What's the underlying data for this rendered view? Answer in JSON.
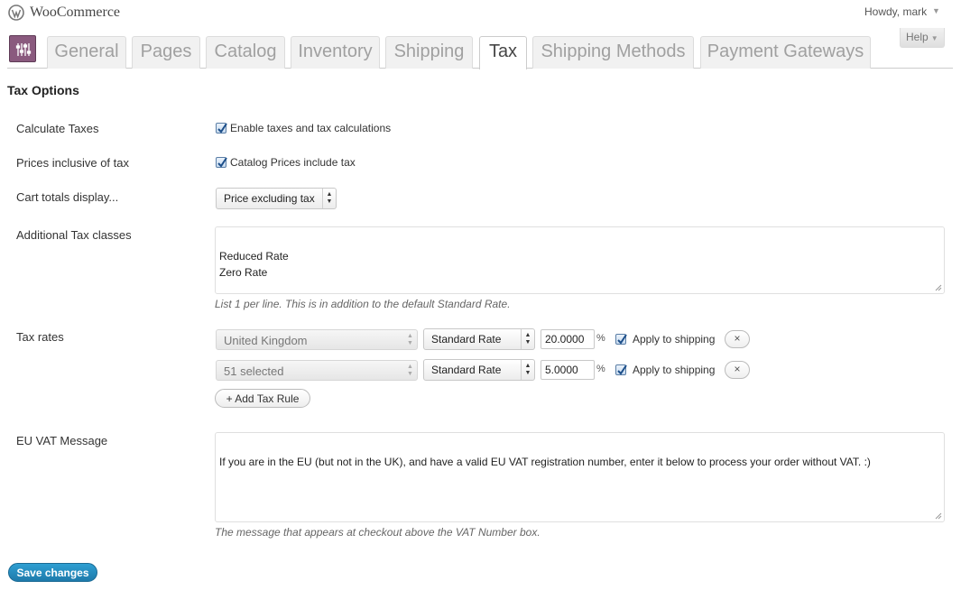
{
  "topbar": {
    "site_name": "WooCommerce",
    "howdy": "Howdy, mark",
    "howdy_arrow": "▼",
    "help": "Help",
    "help_arrow": "▼"
  },
  "tabs": [
    {
      "label": "General",
      "active": false
    },
    {
      "label": "Pages",
      "active": false
    },
    {
      "label": "Catalog",
      "active": false
    },
    {
      "label": "Inventory",
      "active": false
    },
    {
      "label": "Shipping",
      "active": false
    },
    {
      "label": "Tax",
      "active": true
    },
    {
      "label": "Shipping Methods",
      "active": false
    },
    {
      "label": "Payment Gateways",
      "active": false
    }
  ],
  "section_title": "Tax Options",
  "fields": {
    "calculate_taxes": {
      "label": "Calculate Taxes",
      "checkbox_label": "Enable taxes and tax calculations",
      "checked": true
    },
    "prices_inclusive": {
      "label": "Prices inclusive of tax",
      "checkbox_label": "Catalog Prices include tax",
      "checked": true
    },
    "cart_totals": {
      "label": "Cart totals display...",
      "value": "Price excluding tax"
    },
    "tax_classes": {
      "label": "Additional Tax classes",
      "value": "Reduced Rate\nZero Rate",
      "description": "List 1 per line. This is in addition to the default Standard Rate."
    },
    "tax_rates": {
      "label": "Tax rates",
      "rows": [
        {
          "country": "United Kingdom",
          "class": "Standard Rate",
          "rate": "20.0000",
          "pct": "%",
          "apply_label": "Apply to shipping",
          "apply_checked": true,
          "remove": "×"
        },
        {
          "country": "51 selected",
          "class": "Standard Rate",
          "rate": "5.0000",
          "pct": "%",
          "apply_label": "Apply to shipping",
          "apply_checked": true,
          "remove": "×"
        }
      ],
      "add_rule": "+ Add Tax Rule"
    },
    "eu_vat": {
      "label": "EU VAT Message",
      "value": "If you are in the EU (but not in the UK), and have a valid EU VAT registration number, enter it below to process your order without VAT. :)",
      "description": "The message that appears at checkout above the VAT Number box."
    }
  },
  "save_button": "Save changes",
  "colors": {
    "accent": "#21759b",
    "woo_purple": "#8a5a7e",
    "checkbox": "#1d4f8a"
  }
}
